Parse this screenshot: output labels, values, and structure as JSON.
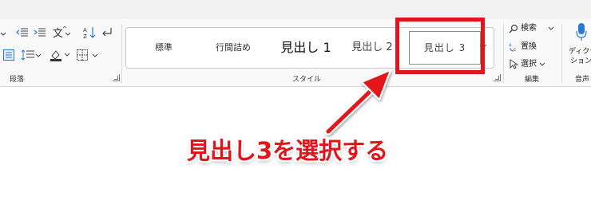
{
  "ribbon": {
    "groups": {
      "paragraph_label": "段落",
      "styles_label": "スタイル",
      "editing_label": "編集",
      "voice_label": "音声"
    },
    "styles": [
      {
        "label": "標準"
      },
      {
        "label": "行間詰め"
      },
      {
        "label": "見出し 1"
      },
      {
        "label": "見出し 2"
      },
      {
        "label": "見出し 3",
        "selected": true
      }
    ],
    "editing": {
      "find_label": "検索",
      "replace_label": "置換",
      "select_label": "選択"
    },
    "voice": {
      "dictate_label_1": "ディクテー",
      "dictate_label_2": "ション"
    }
  },
  "annotation": {
    "text": "見出し3を選択する",
    "color": "#e3141b"
  },
  "colors": {
    "ribbon_bg": "#f9f9f9",
    "accent_red": "#e3141b",
    "mic_blue": "#2b78d6"
  }
}
